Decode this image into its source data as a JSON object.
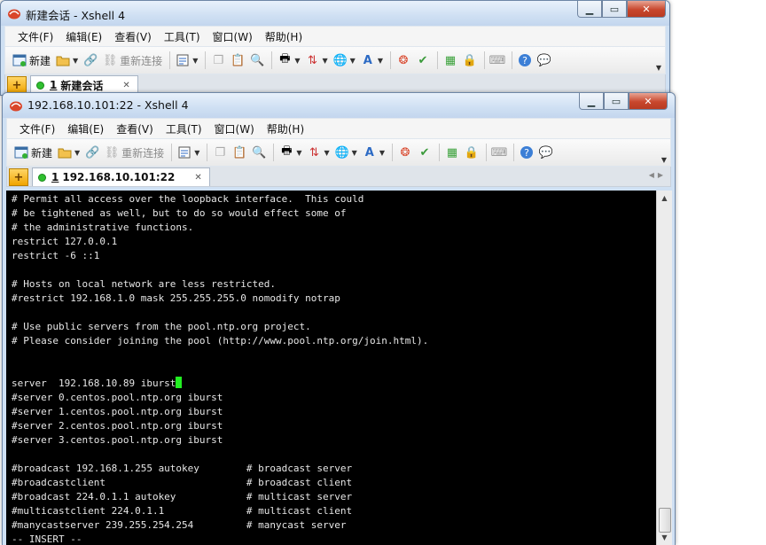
{
  "back_window": {
    "title": "新建会话 - Xshell 4",
    "tab": {
      "number": "1",
      "label": "新建会话"
    }
  },
  "front_window": {
    "title": "192.168.10.101:22 - Xshell 4",
    "tab": {
      "number": "1",
      "label": "192.168.10.101:22"
    }
  },
  "menus": [
    "文件(F)",
    "编辑(E)",
    "查看(V)",
    "工具(T)",
    "窗口(W)",
    "帮助(H)"
  ],
  "toolbar": {
    "new_label": "新建",
    "reconnect_label": "重新连接"
  },
  "window_controls": {
    "minimize": "▁",
    "restore": "▭",
    "close": "✕"
  },
  "terminal": {
    "lines": [
      "# Permit all access over the loopback interface.  This could",
      "# be tightened as well, but to do so would effect some of",
      "# the administrative functions.",
      "restrict 127.0.0.1",
      "restrict -6 ::1",
      "",
      "# Hosts on local network are less restricted.",
      "#restrict 192.168.1.0 mask 255.255.255.0 nomodify notrap",
      "",
      "# Use public servers from the pool.ntp.org project.",
      "# Please consider joining the pool (http://www.pool.ntp.org/join.html).",
      "",
      "",
      "server  192.168.10.89 iburst",
      "#server 0.centos.pool.ntp.org iburst",
      "#server 1.centos.pool.ntp.org iburst",
      "#server 2.centos.pool.ntp.org iburst",
      "#server 3.centos.pool.ntp.org iburst",
      "",
      "#broadcast 192.168.1.255 autokey        # broadcast server",
      "#broadcastclient                        # broadcast client",
      "#broadcast 224.0.1.1 autokey            # multicast server",
      "#multicastclient 224.0.1.1              # multicast client",
      "#manycastserver 239.255.254.254         # manycast server",
      "-- INSERT --"
    ],
    "cursor_line": 13
  },
  "colors": {
    "terminal_bg": "#000000",
    "terminal_fg": "#e6e6e6",
    "cursor": "#22ee22"
  }
}
